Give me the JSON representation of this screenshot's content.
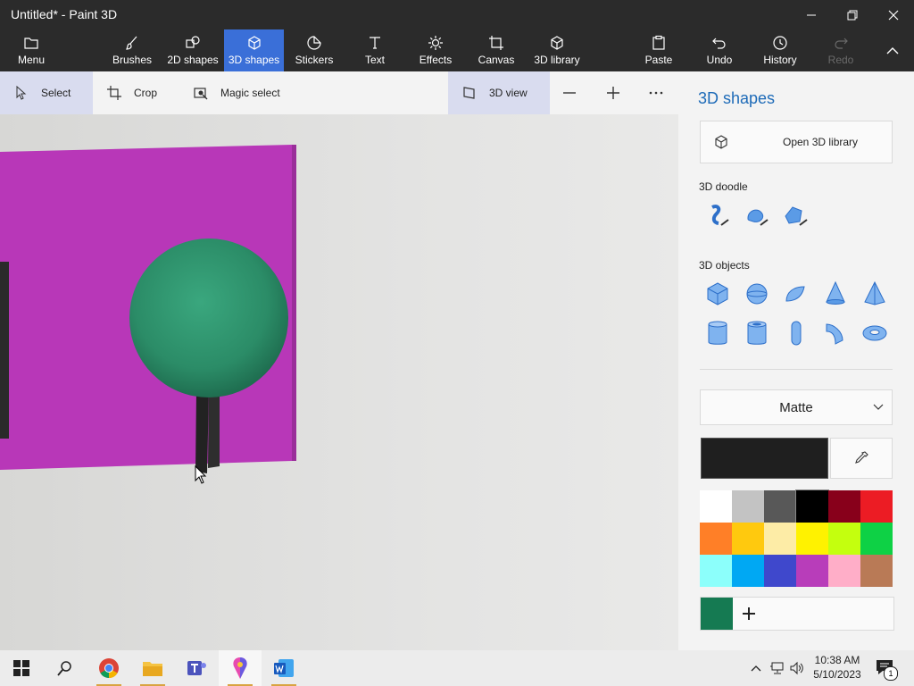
{
  "window": {
    "title": "Untitled* - Paint 3D"
  },
  "ribbon": {
    "menu": "Menu",
    "brushes": "Brushes",
    "shapes2d": "2D shapes",
    "shapes3d": "3D shapes",
    "stickers": "Stickers",
    "text": "Text",
    "effects": "Effects",
    "canvas": "Canvas",
    "library3d": "3D library",
    "paste": "Paste",
    "undo": "Undo",
    "history": "History",
    "redo": "Redo"
  },
  "toolbar": {
    "select": "Select",
    "crop": "Crop",
    "magic_select": "Magic select",
    "view3d": "3D view"
  },
  "panel": {
    "title": "3D shapes",
    "open_library": "Open 3D library",
    "doodle_label": "3D doodle",
    "objects_label": "3D objects",
    "material": "Matte",
    "current_color": "#1f1f1f",
    "palette": [
      "#ffffff",
      "#c3c3c3",
      "#585858",
      "#000000",
      "#88001b",
      "#ec1c24",
      "#ff7f27",
      "#ffc90e",
      "#fdeca6",
      "#fff200",
      "#c4ff0e",
      "#0ed145",
      "#8cfffb",
      "#00a8f3",
      "#3f48cc",
      "#b83dba",
      "#ffaec8",
      "#b97a56"
    ],
    "custom_color": "#157a52"
  },
  "taskbar": {
    "time": "10:38 AM",
    "date": "5/10/2023",
    "notifications": "1"
  }
}
